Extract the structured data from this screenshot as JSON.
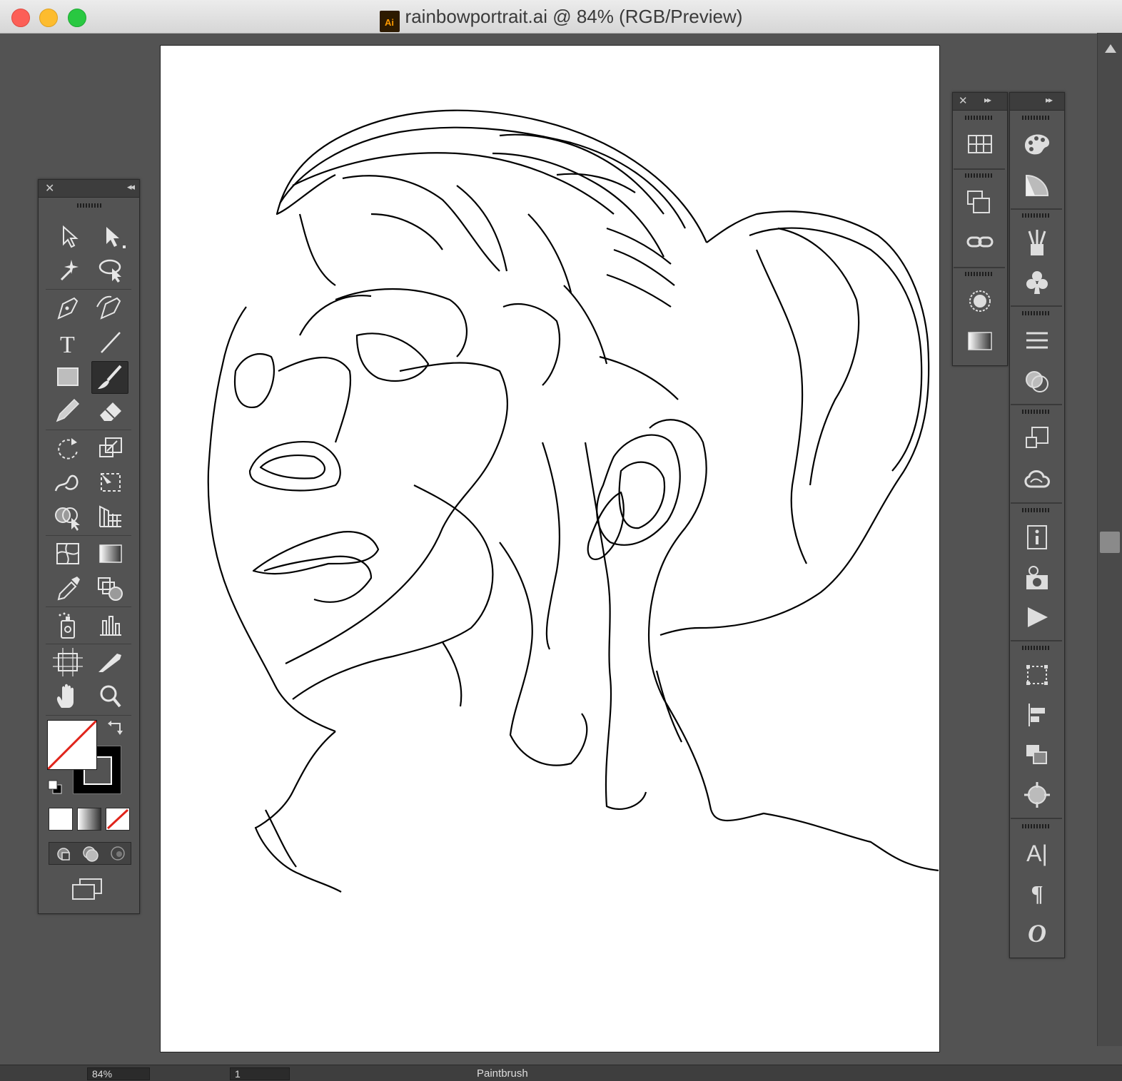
{
  "window": {
    "title": "rainbowportrait.ai @ 84% (RGB/Preview)",
    "app_icon_label": "Ai"
  },
  "tools_panel": {
    "close_glyph": "✕",
    "collapse_glyph": "◂◂",
    "tools": [
      "selection-tool",
      "direct-selection-tool",
      "magic-wand-tool",
      "lasso-tool",
      "pen-tool",
      "curvature-pen-tool",
      "type-tool",
      "line-segment-tool",
      "rectangle-tool",
      "paintbrush-tool",
      "pencil-tool",
      "eraser-tool",
      "rotate-tool",
      "scale-tool",
      "warp-tool",
      "free-transform-tool",
      "shape-builder-tool",
      "perspective-grid-tool",
      "mesh-tool",
      "gradient-tool",
      "eyedropper-tool",
      "blend-tool",
      "symbol-sprayer-tool",
      "column-graph-tool",
      "artboard-tool",
      "slice-tool",
      "hand-tool",
      "zoom-tool"
    ],
    "active_tool": "paintbrush-tool",
    "type_glyph": "T"
  },
  "right_dock": {
    "close_glyph": "✕",
    "expand_glyph": "▸▸",
    "col1": [
      "swatches-icon",
      "transform-icon",
      "links-icon",
      "appearance-icon",
      "gradient-icon"
    ],
    "col2": [
      "color-icon",
      "color-guide-icon",
      "brushes-icon",
      "symbols-icon",
      "stroke-icon",
      "transparency-icon",
      "artboards-icon",
      "creative-cloud-libraries-icon",
      "document-info-icon",
      "asset-export-icon",
      "actions-icon",
      "align-icon",
      "pathfinder-icon",
      "layers-icon",
      "navigator-icon",
      "character-icon",
      "paragraph-icon",
      "opentype-icon"
    ],
    "character_glyph": "A|",
    "paragraph_glyph": "¶",
    "opentype_glyph": "O"
  },
  "status_bar": {
    "zoom": "84%",
    "artboard_number": "1",
    "current_tool": "Paintbrush"
  },
  "colors": {
    "ui_bg": "#535353",
    "panel_head": "#3d3d3d",
    "artboard": "#ffffff",
    "stroke": "#000000",
    "none_slash": "#e0241b"
  }
}
